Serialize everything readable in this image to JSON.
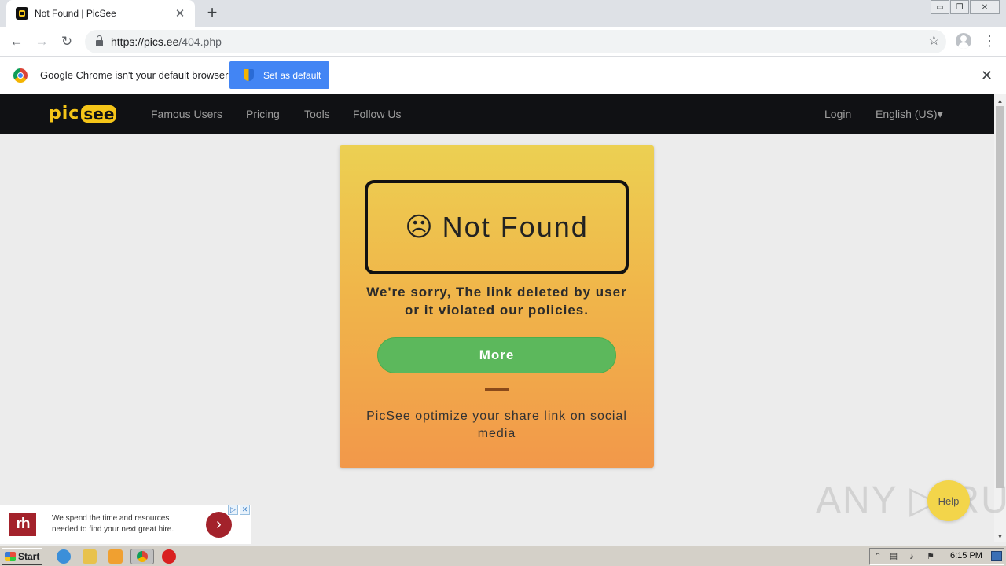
{
  "browser": {
    "tab_title": "Not Found | PicSee",
    "tab_close": "✕",
    "new_tab": "+",
    "url_host": "https://pics.ee",
    "url_path": "/404.php",
    "window_controls": [
      "▭",
      "❐",
      "✕"
    ]
  },
  "infobar": {
    "message": "Google Chrome isn't your default browser",
    "button_label": "Set as default",
    "close": "✕"
  },
  "site": {
    "logo_pic": "pic",
    "logo_see": "see",
    "nav": [
      "Famous Users",
      "Pricing",
      "Tools",
      "Follow Us"
    ],
    "login": "Login",
    "language": "English (US)▾"
  },
  "card": {
    "face": "☹",
    "title": "Not Found",
    "message_line1": "We're sorry, The link deleted by user",
    "message_line2": "or it violated our policies.",
    "button_label": "More",
    "tagline": "PicSee optimize your share link on social media",
    "colors": {
      "gradient_top": "#ecd052",
      "gradient_bottom": "#f2984a",
      "button": "#5cb85c"
    }
  },
  "ad": {
    "logo": "rh",
    "text_line1": "We spend the time and resources",
    "text_line2": "needed to find your next great hire.",
    "arrow": "›"
  },
  "overlay": {
    "watermark": "ANY ▷ RUN",
    "help_label": "Help"
  },
  "taskbar": {
    "start_label": "Start",
    "clock": "6:15 PM"
  }
}
